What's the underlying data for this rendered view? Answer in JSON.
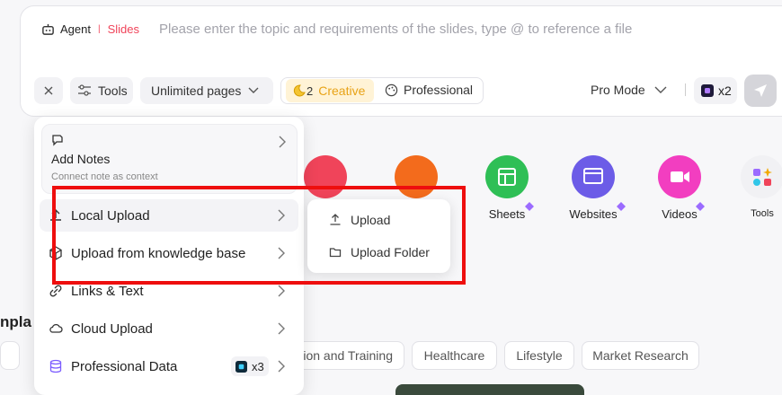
{
  "composer": {
    "agent_label": "Agent",
    "slides_label": "Slides",
    "placeholder": "Please enter the topic and requirements of the slides, type @ to reference a file",
    "tools_label": "Tools",
    "pages_label": "Unlimited pages",
    "creative_count": "2",
    "creative_label": "Creative",
    "professional_label": "Professional",
    "pro_mode_label": "Pro Mode",
    "credits_label": "x2"
  },
  "menu": {
    "add_notes_title": "Add Notes",
    "add_notes_subtitle": "Connect note as context",
    "items": [
      {
        "label": "Local Upload"
      },
      {
        "label": "Upload from knowledge base"
      },
      {
        "label": "Links & Text"
      },
      {
        "label": "Cloud Upload"
      },
      {
        "label": "Professional Data"
      }
    ],
    "professional_badge": "x3"
  },
  "submenu": {
    "items": [
      {
        "label": "Upload"
      },
      {
        "label": "Upload Folder"
      }
    ]
  },
  "tiles": [
    {
      "label": "Sheets",
      "color": "#2fbf56"
    },
    {
      "label": "Websites",
      "color": "#6c5ce7"
    },
    {
      "label": "Videos",
      "color": "#f23ec0"
    },
    {
      "label": "Tools",
      "color": "#f1f1f4"
    }
  ],
  "section_label": "npla",
  "tags": [
    {
      "label": "ion and Training"
    },
    {
      "label": "Healthcare"
    },
    {
      "label": "Lifestyle"
    },
    {
      "label": "Market Research"
    }
  ],
  "colors": {
    "slides": "#f0445a",
    "creative": "#e8a317",
    "highlight_box": "#ee0e0e"
  }
}
